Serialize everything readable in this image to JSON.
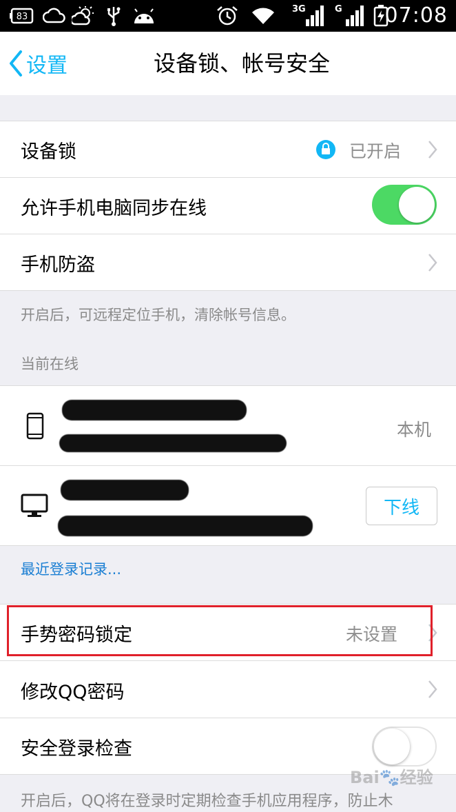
{
  "status_bar": {
    "battery_level": "83",
    "signal_3g": "3G",
    "signal_g": "G",
    "time": "07:08"
  },
  "nav": {
    "back_label": "设置",
    "title": "设备锁、帐号安全"
  },
  "device_lock": {
    "label": "设备锁",
    "status": "已开启"
  },
  "sync_online": {
    "label": "允许手机电脑同步在线",
    "enabled": true
  },
  "anti_theft": {
    "label": "手机防盗",
    "note": "开启后，可远程定位手机，清除帐号信息。"
  },
  "online_section": {
    "header": "当前在线",
    "devices": [
      {
        "icon": "phone-icon",
        "status": "本机"
      },
      {
        "icon": "monitor-icon",
        "action": "下线"
      }
    ],
    "recent_login_link": "最近登录记录..."
  },
  "gesture_lock": {
    "label": "手势密码锁定",
    "value": "未设置"
  },
  "change_password": {
    "label": "修改QQ密码"
  },
  "safe_login_check": {
    "label": "安全登录检查",
    "enabled": false,
    "note": "开启后，QQ将在登录时定期检查手机应用程序，防止木"
  },
  "colors": {
    "accent": "#12b7f5",
    "toggle_on": "#4cd964",
    "highlight": "#e0202a",
    "link": "#1b7fd3"
  }
}
